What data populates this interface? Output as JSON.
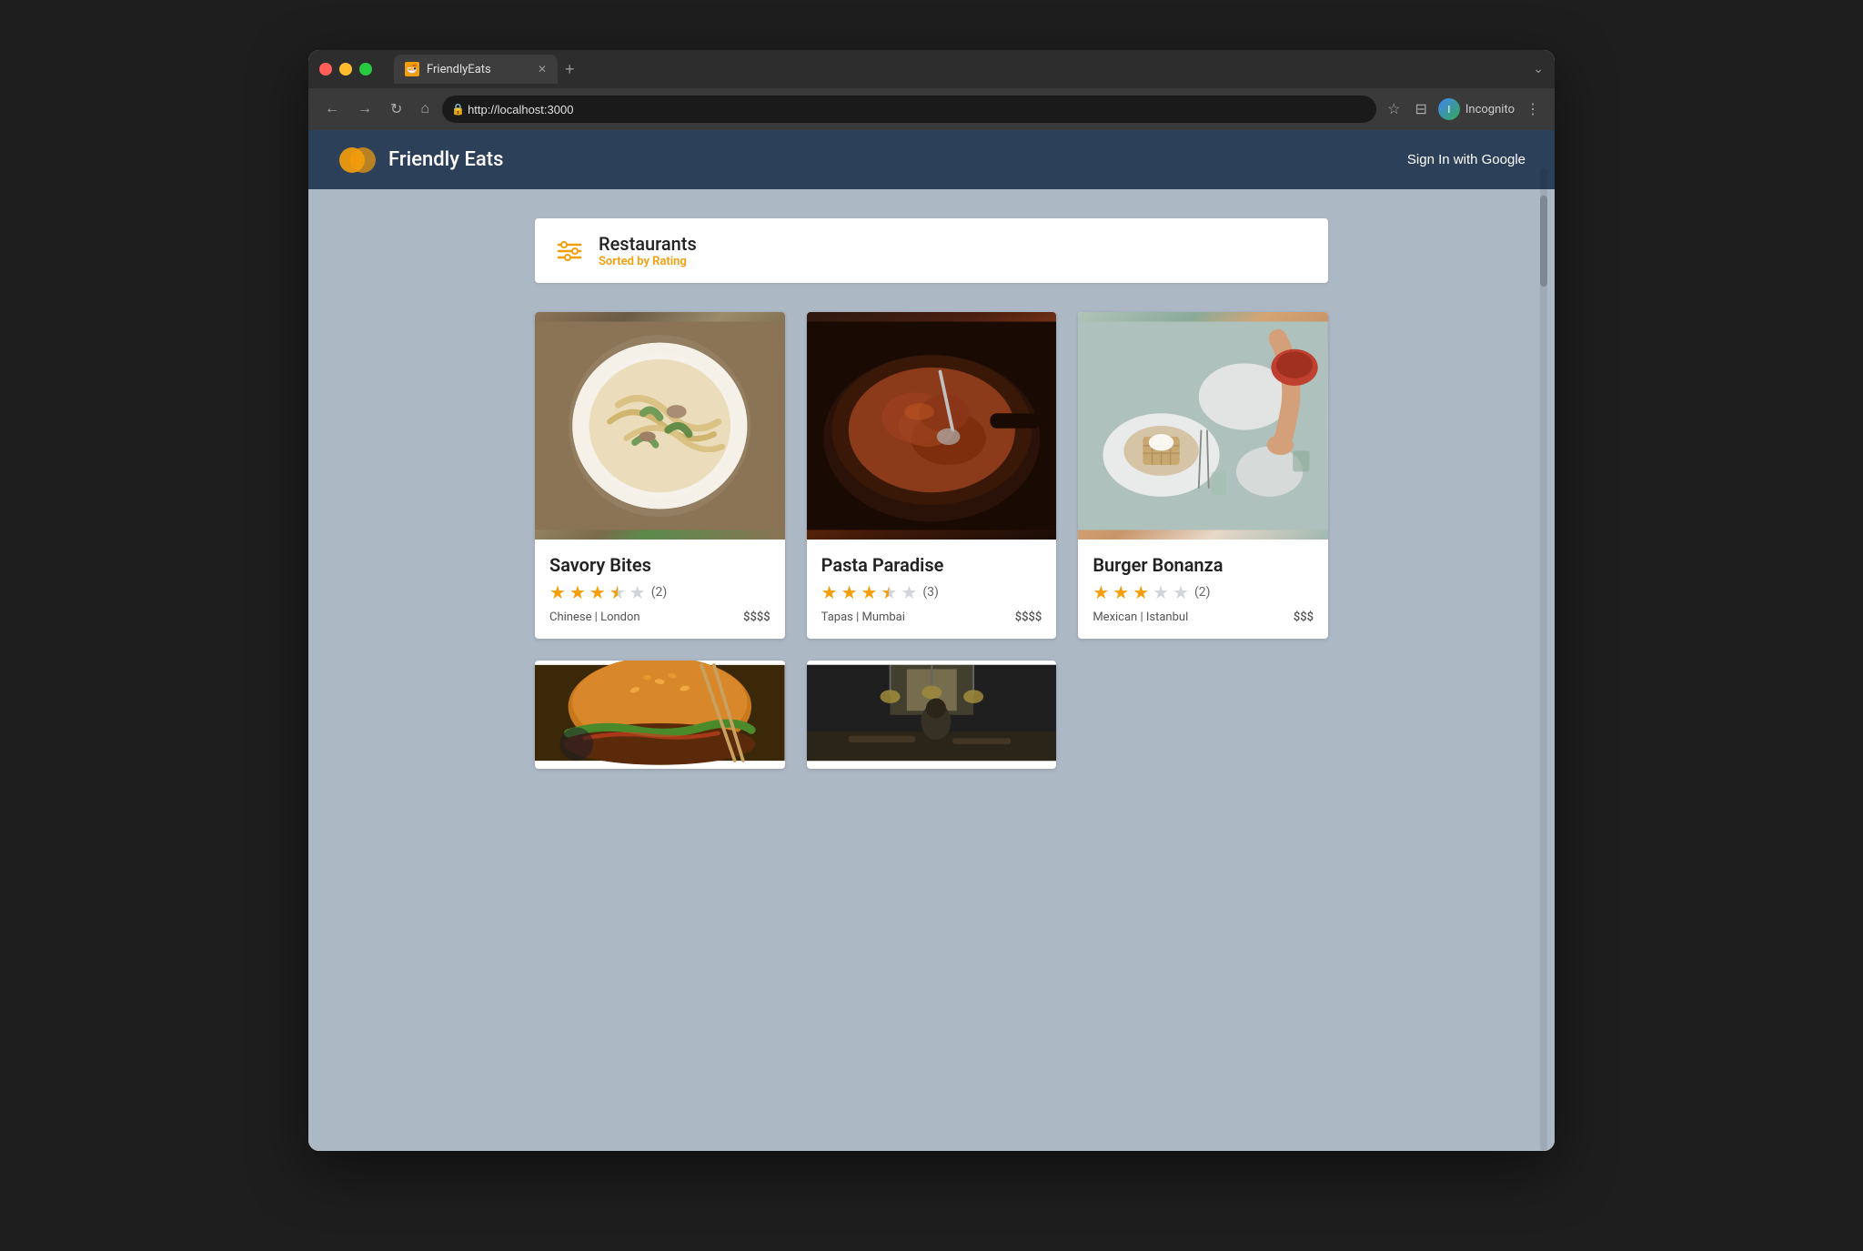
{
  "browser": {
    "url": "http://localhost:3000",
    "tab_title": "FriendlyEats",
    "new_tab_symbol": "+",
    "nav": {
      "back": "←",
      "forward": "→",
      "refresh": "↻",
      "home": "⌂"
    },
    "toolbar_right": {
      "star": "☆",
      "split_view": "⊟",
      "profile_name": "Incognito",
      "menu": "⋮",
      "chevron": "⌄"
    }
  },
  "app": {
    "title": "Friendly Eats",
    "sign_in_label": "Sign In with Google",
    "header_section": {
      "section_title": "Restaurants",
      "sort_label": "Sorted by Rating"
    },
    "restaurants": [
      {
        "name": "Savory Bites",
        "rating": 3.5,
        "full_stars": 3,
        "half_star": true,
        "review_count": "(2)",
        "cuisine": "Chinese",
        "location": "London",
        "price": "$$$$",
        "image_class": "food-image-1"
      },
      {
        "name": "Pasta Paradise",
        "rating": 3.5,
        "full_stars": 3,
        "half_star": true,
        "review_count": "(3)",
        "cuisine": "Tapas",
        "location": "Mumbai",
        "price": "$$$$",
        "image_class": "food-image-2"
      },
      {
        "name": "Burger Bonanza",
        "rating": 3,
        "full_stars": 3,
        "half_star": false,
        "review_count": "(2)",
        "cuisine": "Mexican",
        "location": "Istanbul",
        "price": "$$$",
        "image_class": "food-image-3"
      }
    ],
    "bottom_restaurants": [
      {
        "image_class": "food-image-4",
        "visible": true
      },
      {
        "image_class": "food-image-5",
        "visible": true
      }
    ],
    "colors": {
      "header_bg": "#2d4059",
      "body_bg": "#adb8c5",
      "star_color": "#f59e0b",
      "star_empty": "#d1d5db"
    }
  }
}
